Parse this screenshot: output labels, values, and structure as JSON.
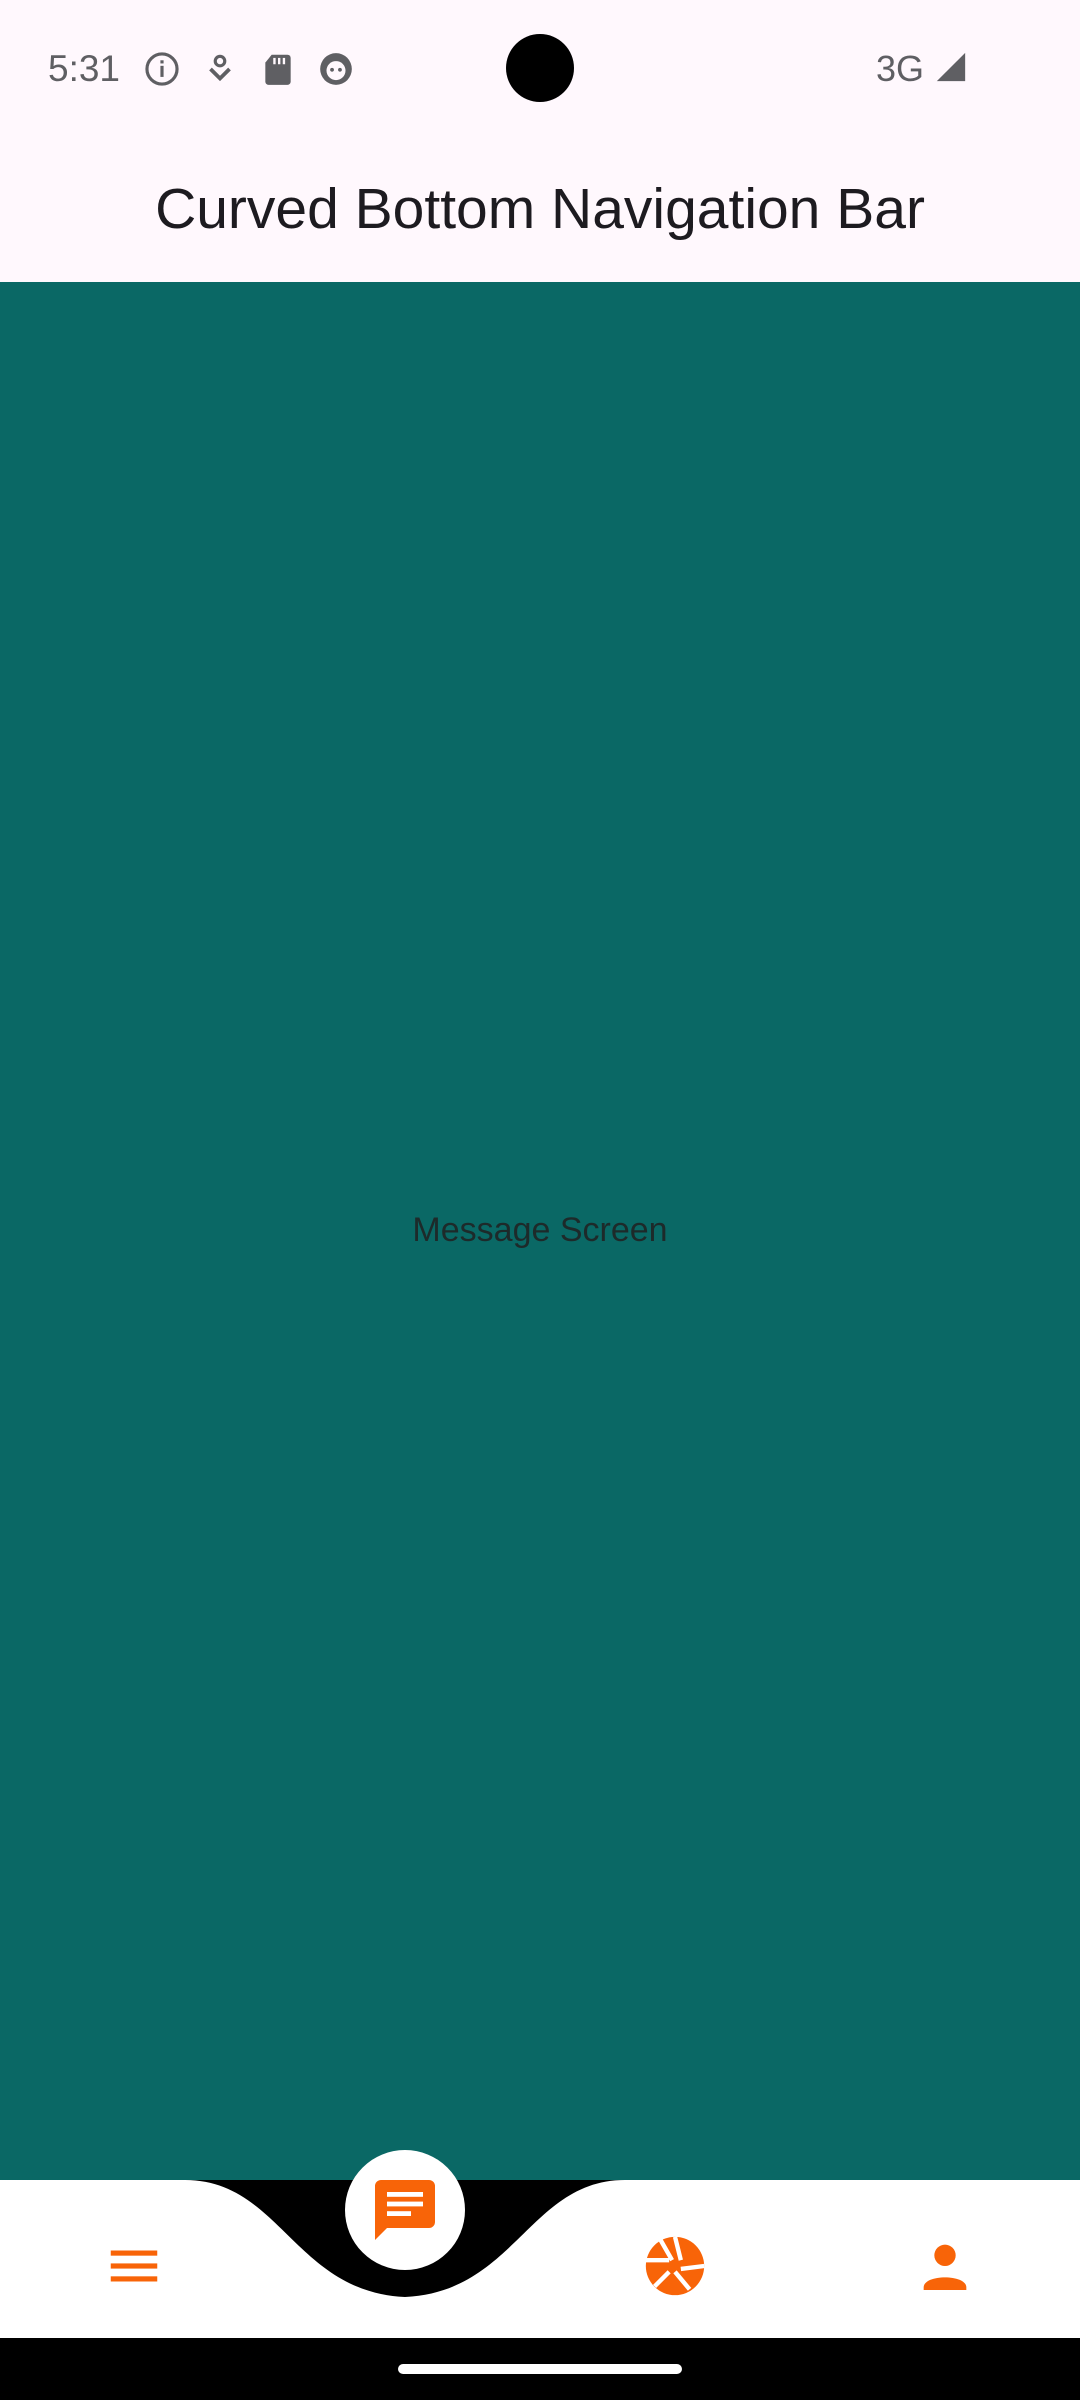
{
  "status_bar": {
    "time": "5:31",
    "network": "3G",
    "icons": [
      "info-icon",
      "download-icon",
      "sd-card-icon",
      "android-debug-icon",
      "signal-icon"
    ]
  },
  "app_bar": {
    "title": "Curved Bottom Navigation Bar"
  },
  "content": {
    "label": "Message Screen",
    "background": "#0A6865"
  },
  "bottom_nav": {
    "accent_color": "#F86408",
    "active_index": 1,
    "items": [
      {
        "icon": "menu-icon"
      },
      {
        "icon": "message-icon"
      },
      {
        "icon": "camera-aperture-icon"
      },
      {
        "icon": "person-icon"
      }
    ]
  }
}
